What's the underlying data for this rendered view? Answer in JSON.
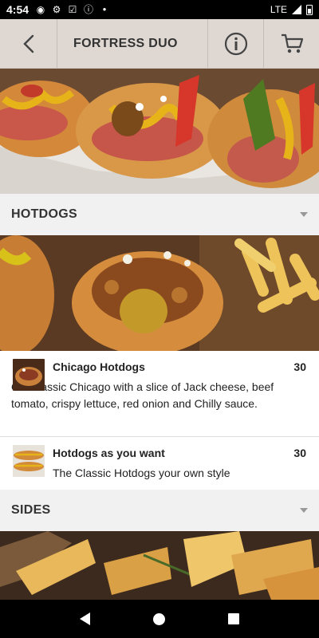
{
  "status_bar": {
    "time": "4:54",
    "network": "LTE",
    "left_icons": [
      "notification-icon",
      "gear-icon",
      "clipboard-check-icon",
      "info-icon",
      "dot-icon"
    ],
    "right_icons": [
      "signal-icon",
      "battery-icon"
    ]
  },
  "header": {
    "title": "FORTRESS DUO",
    "back_icon": "chevron-left-icon",
    "info_icon": "info-circle-icon",
    "cart_icon": "cart-icon"
  },
  "sections": [
    {
      "label": "HOTDOGS",
      "items": [
        {
          "name": "Chicago Hotdogs",
          "price": "30",
          "description": "Our classic Chicago with a slice of Jack cheese, beef tomato, crispy lettuce, red onion and Chilly sauce."
        },
        {
          "name": "Hotdogs as you want",
          "price": "30",
          "description": "The Classic Hotdogs your own style"
        }
      ]
    },
    {
      "label": "SIDES",
      "items": []
    }
  ],
  "nav_bar": {
    "icons": [
      "back-triangle-icon",
      "home-circle-icon",
      "recents-square-icon"
    ]
  },
  "colors": {
    "section_bg": "#f1f1f1",
    "text": "#222222",
    "bun": "#d4883a",
    "sausage": "#c9584a",
    "mustard": "#e6b419"
  }
}
